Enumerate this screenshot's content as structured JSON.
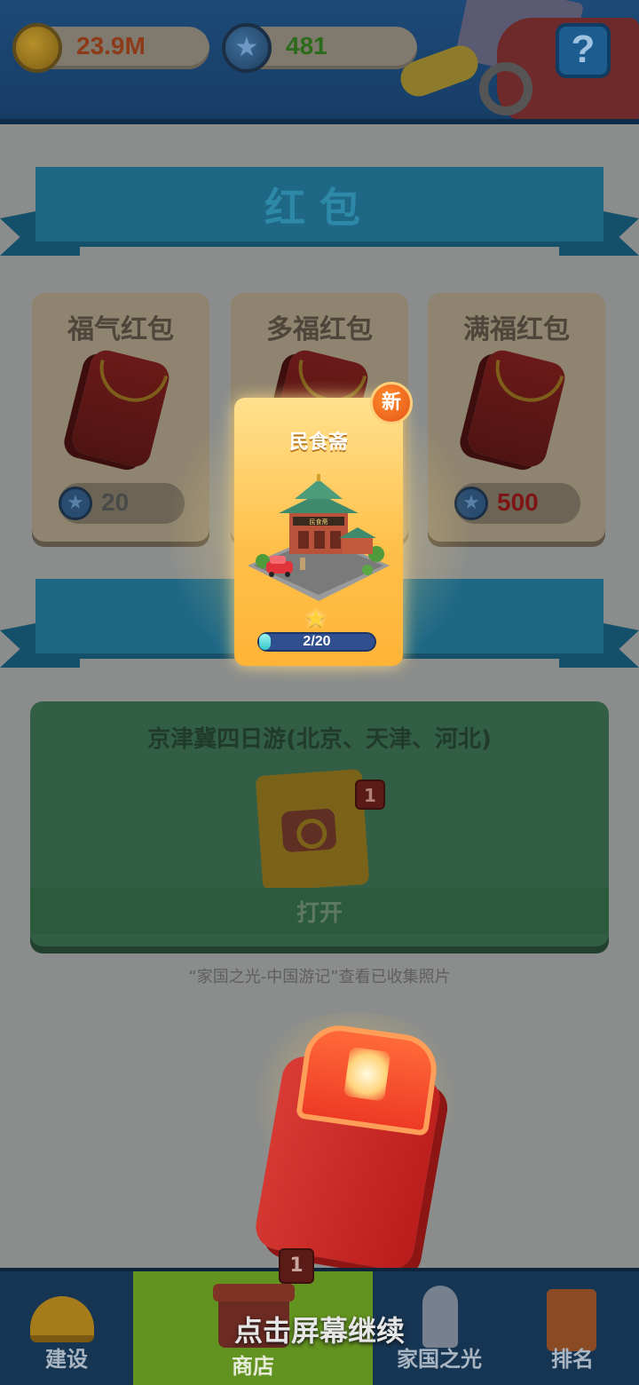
{
  "colors": {
    "coin_value": "#8c3a18",
    "gem_value": "#2d6b1c",
    "price_normal": "#4a4a4a",
    "price_premium": "#7d1515"
  },
  "resources": {
    "coins": "23.9M",
    "gems": "481",
    "coin_icon": "gold-coin-icon",
    "gem_icon": "blue-star-gem-icon"
  },
  "help": {
    "label": "?"
  },
  "section": {
    "title": "红包"
  },
  "packets": [
    {
      "name": "福气红包",
      "price": "20"
    },
    {
      "name": "多福红包",
      "price": ""
    },
    {
      "name": "满福红包",
      "price": "500"
    }
  ],
  "album": {
    "title": "京津冀四日游(北京、天津、河北)",
    "badge": "1",
    "open_label": "打开",
    "hint": "“家国之光-中国游记”查看已收集照片"
  },
  "reward": {
    "new_badge": "新",
    "name": "民食斋",
    "sign": "民食斋",
    "stars": 1,
    "progress_text": "2/20",
    "progress_current": 2,
    "progress_total": 20
  },
  "tap_hint": "点击屏幕继续",
  "nav": {
    "badge": "1",
    "items": [
      {
        "label": "建设",
        "icon": "hard-hat-icon"
      },
      {
        "label": "商店",
        "icon": "shop-icon"
      },
      {
        "label": "家国之光",
        "icon": "rocket-icon"
      },
      {
        "label": "排名",
        "icon": "tower-icon"
      }
    ]
  }
}
